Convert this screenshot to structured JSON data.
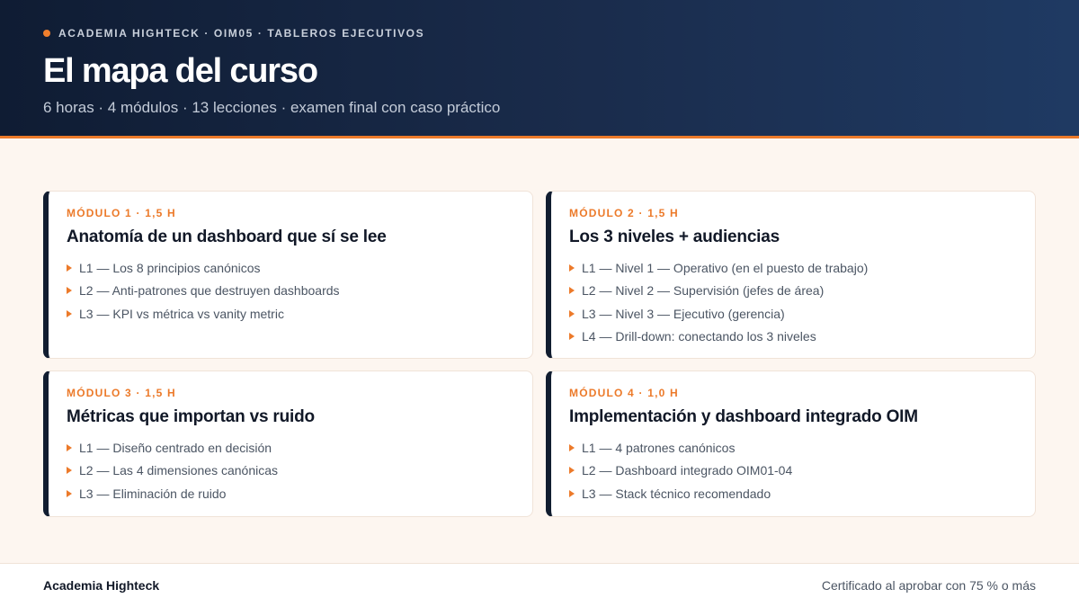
{
  "header": {
    "kicker": "ACADEMIA HIGHTECK · OIM05 · TABLEROS EJECUTIVOS",
    "title": "El mapa del curso",
    "subtitle": "6 horas · 4 módulos · 13 lecciones · examen final con caso práctico"
  },
  "modules": [
    {
      "label": "MÓDULO 1 · 1,5 H",
      "title": "Anatomía de un dashboard que sí se lee",
      "lessons": [
        "L1 — Los 8 principios canónicos",
        "L2 — Anti-patrones que destruyen dashboards",
        "L3 — KPI vs métrica vs vanity metric"
      ]
    },
    {
      "label": "MÓDULO 2 · 1,5 H",
      "title": "Los 3 niveles + audiencias",
      "lessons": [
        "L1 — Nivel 1 — Operativo (en el puesto de trabajo)",
        "L2 — Nivel 2 — Supervisión (jefes de área)",
        "L3 — Nivel 3 — Ejecutivo (gerencia)",
        "L4 — Drill-down: conectando los 3 niveles"
      ]
    },
    {
      "label": "MÓDULO 3 · 1,5 H",
      "title": "Métricas que importan vs ruido",
      "lessons": [
        "L1 — Diseño centrado en decisión",
        "L2 — Las 4 dimensiones canónicas",
        "L3 — Eliminación de ruido"
      ]
    },
    {
      "label": "MÓDULO 4 · 1,0 H",
      "title": "Implementación y dashboard integrado OIM",
      "lessons": [
        "L1 — 4 patrones canónicos",
        "L2 — Dashboard integrado OIM01-04",
        "L3 — Stack técnico recomendado"
      ]
    }
  ],
  "footer": {
    "brand": "Academia Highteck",
    "note": "Certificado al aprobar con 75 % o más"
  },
  "colors": {
    "accent": "#ec7a2a",
    "header_dark": "#0f1c33",
    "card_border_left": "#111d30"
  }
}
